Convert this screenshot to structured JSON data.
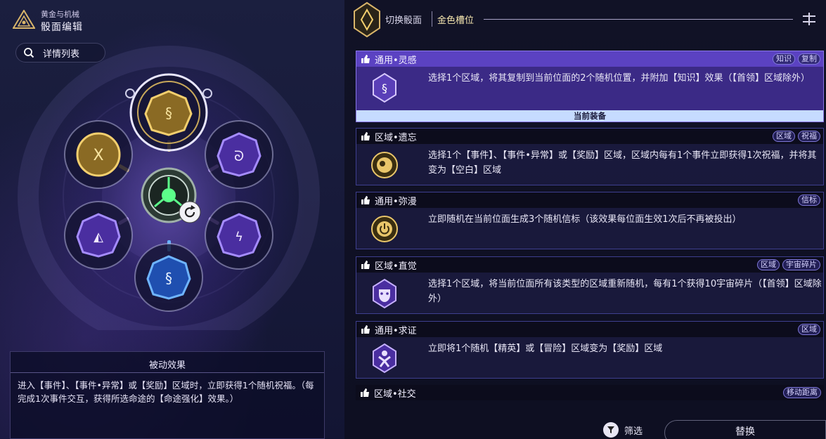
{
  "header": {
    "subtitle": "黄金与机械",
    "title": "骰面编辑"
  },
  "detail_button": {
    "label": "详情列表"
  },
  "passive": {
    "title": "被动效果",
    "text": "进入【事件】、【事件•异常】或【奖励】区域时，立即获得1个随机祝福。（每完成1次事件交互，获得所选命途的【命途强化】效果。）"
  },
  "topbar": {
    "switch_label": "切换骰面",
    "slot_label": "金色槽位"
  },
  "cards": [
    {
      "title": "通用•灵感",
      "tags": [
        "知识",
        "复制"
      ],
      "text": "选择1个区域，将其复制到当前位面的2个随机位置，并附加【知识】效果（【首领】区域除外）",
      "equipped": "当前装备",
      "icon": "gold-swirl-icon"
    },
    {
      "title": "区域•遗忘",
      "tags": [
        "区域",
        "祝福"
      ],
      "text": "选择1个【事件】、【事件•异常】或【奖励】区域，区域内每有1个事件立即获得1次祝福，并将其变为【空白】区域",
      "icon": "gold-orbit-icon"
    },
    {
      "title": "通用•弥漫",
      "tags": [
        "信标"
      ],
      "text": "立即随机在当前位面生成3个随机信标（该效果每位面生效1次后不再被投出）",
      "icon": "gold-power-icon"
    },
    {
      "title": "区域•直觉",
      "tags": [
        "区域",
        "宇宙碎片"
      ],
      "text": "选择1个区域，将当前位面所有该类型的区域重新随机，每有1个获得10宇宙碎片（【首领】区域除外）",
      "icon": "purple-mask-icon"
    },
    {
      "title": "通用•求证",
      "tags": [
        "区域"
      ],
      "text": "立即将1个随机【精英】或【冒险】区域变为【奖励】区域",
      "icon": "purple-figure-icon"
    },
    {
      "title": "区域•社交",
      "tags": [
        "移动距离"
      ],
      "text": "",
      "icon": ""
    }
  ],
  "footer": {
    "filter_label": "筛选",
    "replace_label": "替换"
  }
}
